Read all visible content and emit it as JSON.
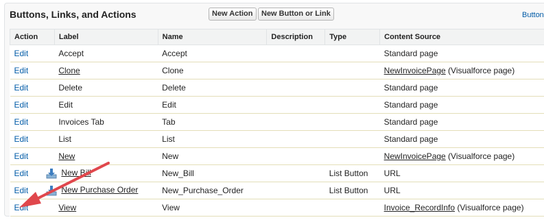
{
  "section": {
    "title": "Buttons, Links, and Actions",
    "new_action_label": "New Action",
    "new_button_label": "New Button or Link",
    "help_link": "Button"
  },
  "columns": [
    "Action",
    "Label",
    "Name",
    "Description",
    "Type",
    "Content Source"
  ],
  "rows": [
    {
      "action": "Edit",
      "label": "Accept",
      "label_linked": false,
      "icon": "",
      "name": "Accept",
      "description": "",
      "type": "",
      "source": "Standard page",
      "source_link": "",
      "source_suffix": ""
    },
    {
      "action": "Edit",
      "label": "Clone",
      "label_linked": true,
      "icon": "",
      "name": "Clone",
      "description": "",
      "type": "",
      "source": "",
      "source_link": "NewInvoicePage",
      "source_suffix": " (Visualforce page)"
    },
    {
      "action": "Edit",
      "label": "Delete",
      "label_linked": false,
      "icon": "",
      "name": "Delete",
      "description": "",
      "type": "",
      "source": "Standard page",
      "source_link": "",
      "source_suffix": ""
    },
    {
      "action": "Edit",
      "label": "Edit",
      "label_linked": false,
      "icon": "",
      "name": "Edit",
      "description": "",
      "type": "",
      "source": "Standard page",
      "source_link": "",
      "source_suffix": ""
    },
    {
      "action": "Edit",
      "label": "Invoices Tab",
      "label_linked": false,
      "icon": "",
      "name": "Tab",
      "description": "",
      "type": "",
      "source": "Standard page",
      "source_link": "",
      "source_suffix": ""
    },
    {
      "action": "Edit",
      "label": "List",
      "label_linked": false,
      "icon": "",
      "name": "List",
      "description": "",
      "type": "",
      "source": "Standard page",
      "source_link": "",
      "source_suffix": ""
    },
    {
      "action": "Edit",
      "label": "New",
      "label_linked": true,
      "icon": "",
      "name": "New",
      "description": "",
      "type": "",
      "source": "",
      "source_link": "NewInvoicePage",
      "source_suffix": " (Visualforce page)"
    },
    {
      "action": "Edit",
      "label": "New Bill",
      "label_linked": true,
      "icon": "download-icon",
      "name": "New_Bill",
      "description": "",
      "type": "List Button",
      "source": "URL",
      "source_link": "",
      "source_suffix": ""
    },
    {
      "action": "Edit",
      "label": "New Purchase Order",
      "label_linked": true,
      "icon": "download-icon",
      "name": "New_Purchase_Order",
      "description": "",
      "type": "List Button",
      "source": "URL",
      "source_link": "",
      "source_suffix": ""
    },
    {
      "action": "Edit",
      "label": "View",
      "label_linked": true,
      "icon": "",
      "name": "View",
      "description": "",
      "type": "",
      "source": "",
      "source_link": "Invoice_RecordInfo",
      "source_suffix": " (Visualforce page)"
    }
  ],
  "annotation": {
    "icon": "red-arrow-icon",
    "color": "#e0474c"
  },
  "colors": {
    "link": "#015ba7",
    "header_bg": "#f2f3f3",
    "row_border": "#e3deb8"
  }
}
